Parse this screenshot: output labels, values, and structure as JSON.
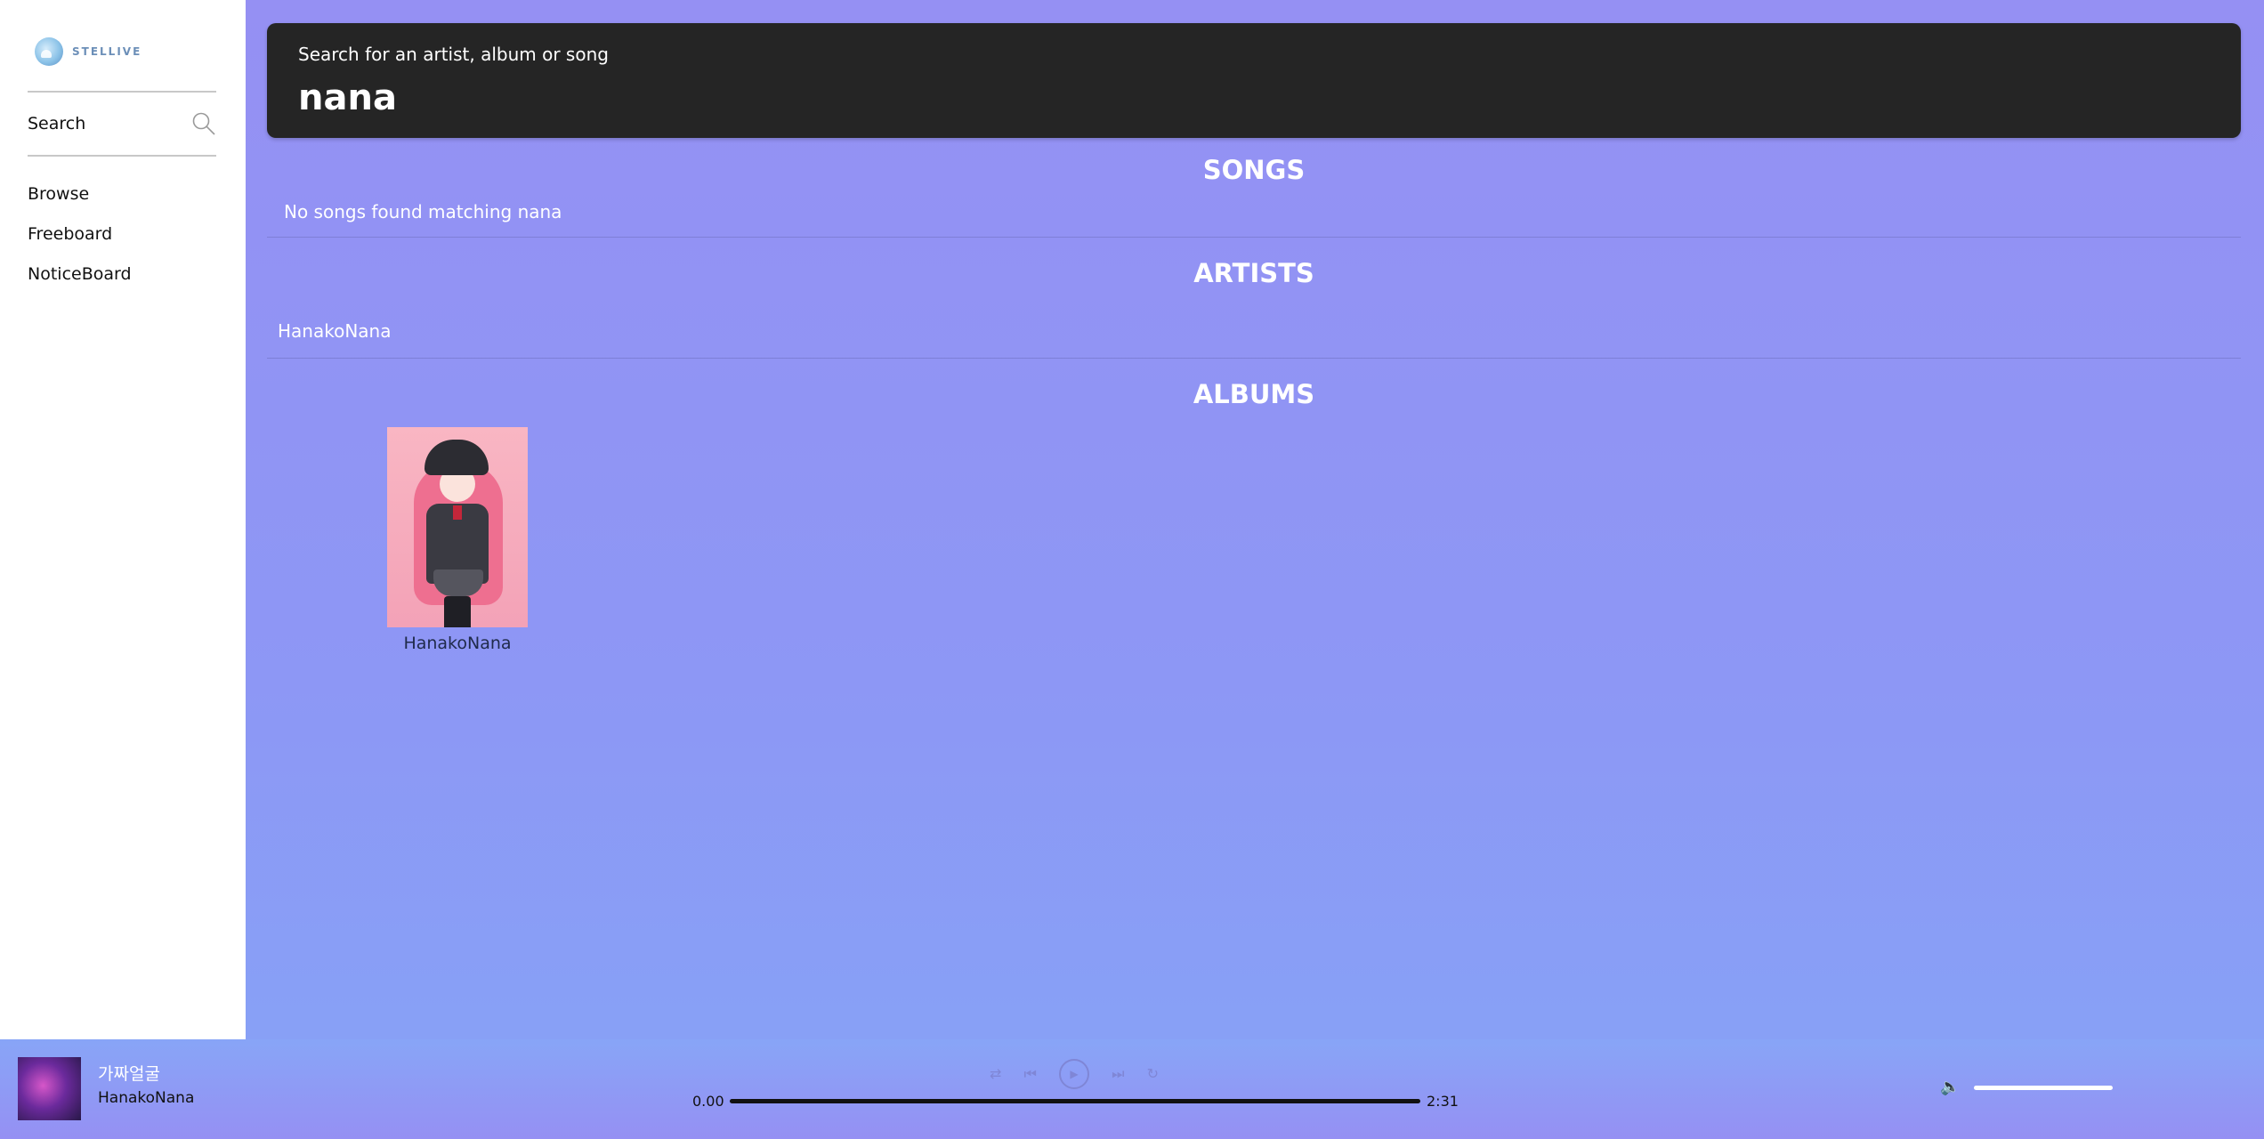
{
  "brand": {
    "logo_text": "STELLIVE"
  },
  "sidebar": {
    "search_label": "Search",
    "nav": [
      {
        "label": "Browse"
      },
      {
        "label": "Freeboard"
      },
      {
        "label": "NoticeBoard"
      }
    ]
  },
  "search": {
    "hint": "Search for an artist, album or song",
    "query": "nana"
  },
  "results": {
    "songs": {
      "title": "SONGS",
      "empty_message": "No songs found matching nana"
    },
    "artists": {
      "title": "ARTISTS",
      "items": [
        "HanakoNana"
      ]
    },
    "albums": {
      "title": "ALBUMS",
      "items": [
        {
          "label": "HanakoNana"
        }
      ]
    }
  },
  "player": {
    "track_title": "가짜얼굴",
    "track_artist": "HanakoNana",
    "elapsed": "0.00",
    "duration": "2:31",
    "progress": 0,
    "icons": [
      "shuffle-icon",
      "previous-icon",
      "play-icon",
      "next-icon",
      "repeat-icon",
      "volume-icon"
    ]
  },
  "colors": {
    "background_top": "#9590f3",
    "background_bottom": "#86a3f6",
    "search_bar": "#252525",
    "sidebar": "#ffffff"
  }
}
